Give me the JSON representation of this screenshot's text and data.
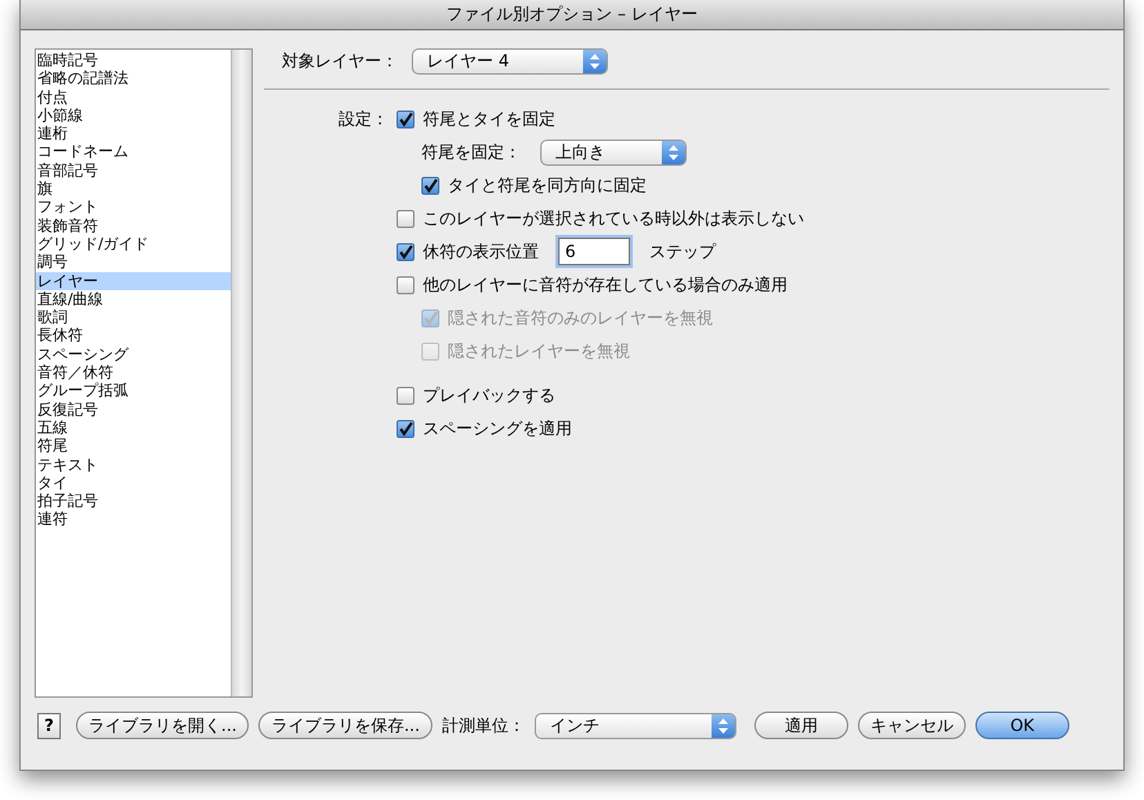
{
  "window": {
    "title": "ファイル別オプション – レイヤー"
  },
  "sidebar": {
    "items": [
      {
        "label": "臨時記号",
        "selected": false
      },
      {
        "label": "省略の記譜法",
        "selected": false
      },
      {
        "label": "付点",
        "selected": false
      },
      {
        "label": "小節線",
        "selected": false
      },
      {
        "label": "連桁",
        "selected": false
      },
      {
        "label": "コードネーム",
        "selected": false
      },
      {
        "label": "音部記号",
        "selected": false
      },
      {
        "label": "旗",
        "selected": false
      },
      {
        "label": "フォント",
        "selected": false
      },
      {
        "label": "装飾音符",
        "selected": false
      },
      {
        "label": "グリッド/ガイド",
        "selected": false
      },
      {
        "label": "調号",
        "selected": false
      },
      {
        "label": "レイヤー",
        "selected": true
      },
      {
        "label": "直線/曲線",
        "selected": false
      },
      {
        "label": "歌詞",
        "selected": false
      },
      {
        "label": "長休符",
        "selected": false
      },
      {
        "label": "スペーシング",
        "selected": false
      },
      {
        "label": "音符／休符",
        "selected": false
      },
      {
        "label": "グループ括弧",
        "selected": false
      },
      {
        "label": "反復記号",
        "selected": false
      },
      {
        "label": "五線",
        "selected": false
      },
      {
        "label": "符尾",
        "selected": false
      },
      {
        "label": "テキスト",
        "selected": false
      },
      {
        "label": "タイ",
        "selected": false
      },
      {
        "label": "拍子記号",
        "selected": false
      },
      {
        "label": "連符",
        "selected": false
      }
    ]
  },
  "target_layer": {
    "label": "対象レイヤー：",
    "value": "レイヤー 4"
  },
  "settings": {
    "label": "設定：",
    "options": [
      {
        "kind": "checkbox",
        "label": "符尾とタイを固定",
        "checked": true,
        "disabled": false,
        "children": [
          {
            "kind": "select",
            "label": "符尾を固定：",
            "value": "上向き"
          },
          {
            "kind": "checkbox",
            "label": "タイと符尾を同方向に固定",
            "checked": true,
            "disabled": false
          }
        ]
      },
      {
        "kind": "checkbox",
        "label": "このレイヤーが選択されている時以外は表示しない",
        "checked": false,
        "disabled": false
      },
      {
        "kind": "checkbox_field",
        "label": "休符の表示位置",
        "checked": true,
        "disabled": false,
        "value": "6",
        "unit": "ステップ"
      },
      {
        "kind": "checkbox",
        "label": "他のレイヤーに音符が存在している場合のみ適用",
        "checked": false,
        "disabled": false,
        "children": [
          {
            "kind": "checkbox",
            "label": "隠された音符のみのレイヤーを無視",
            "checked": true,
            "disabled": true
          },
          {
            "kind": "checkbox",
            "label": "隠されたレイヤーを無視",
            "checked": false,
            "disabled": true
          }
        ]
      },
      {
        "kind": "gap"
      },
      {
        "kind": "checkbox",
        "label": "プレイバックする",
        "checked": false,
        "disabled": false
      },
      {
        "kind": "checkbox",
        "label": "スペーシングを適用",
        "checked": true,
        "disabled": false
      }
    ]
  },
  "footer": {
    "help": "?",
    "load_button": "ライブラリを開く...",
    "save_button": "ライブラリを保存...",
    "unit_label": "計測単位：",
    "unit_value": "インチ",
    "apply_button": "適用",
    "cancel_button": "キャンセル",
    "ok_button": "OK"
  }
}
